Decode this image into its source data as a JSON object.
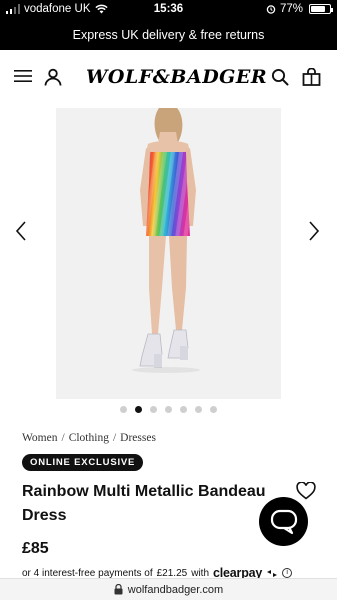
{
  "status_bar": {
    "carrier": "vodafone UK",
    "time": "15:36",
    "battery_percent": "77%",
    "battery_level": 0.77
  },
  "promo_banner": {
    "text": "Express UK delivery & free returns"
  },
  "header": {
    "logo": "WOLF&BADGER",
    "icons": [
      "menu-icon",
      "account-icon",
      "search-icon",
      "bag-icon"
    ]
  },
  "product": {
    "image_count": 7,
    "active_image_index": 1,
    "breadcrumb": [
      "Women",
      "Clothing",
      "Dresses"
    ],
    "badge": "ONLINE EXCLUSIVE",
    "title": "Rainbow Multi Metallic Bandeau Dress",
    "price": "£85",
    "payment_prefix": "or 4 interest-free payments of",
    "payment_amount": "£21.25",
    "payment_with": "with",
    "payment_brand": "clearpay",
    "info_glyph": "i"
  },
  "url_bar": {
    "url": "wolfandbadger.com"
  },
  "colors": {
    "black": "#000000",
    "image_background": "#f2f1f1",
    "dot_inactive": "#cfcfcf"
  }
}
